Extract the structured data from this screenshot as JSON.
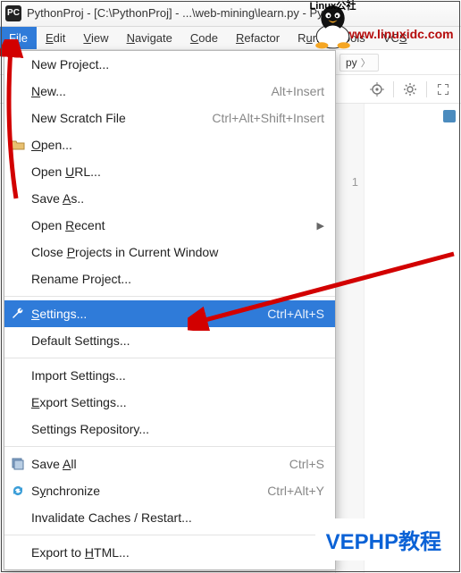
{
  "window": {
    "title": "PythonProj - [C:\\PythonProj] - ...\\web-mining\\learn.py - PyCh"
  },
  "menubar": {
    "items": [
      {
        "label": "File",
        "u": 0,
        "active": true
      },
      {
        "label": "Edit",
        "u": 0
      },
      {
        "label": "View",
        "u": 0
      },
      {
        "label": "Navigate",
        "u": 0
      },
      {
        "label": "Code",
        "u": 0
      },
      {
        "label": "Refactor",
        "u": 0
      },
      {
        "label": "Run",
        "u": 1
      },
      {
        "label": "Tools",
        "u": 0
      },
      {
        "label": "VCS",
        "u": 2
      }
    ]
  },
  "breadcrumb": {
    "tail": "py"
  },
  "dropdown": {
    "groups": [
      [
        {
          "label": "New Project..."
        },
        {
          "label": "New...",
          "u": 0,
          "shortcut": "Alt+Insert"
        },
        {
          "label": "New Scratch File",
          "shortcut": "Ctrl+Alt+Shift+Insert"
        },
        {
          "label": "Open...",
          "u": 0,
          "icon": "folder-open-icon"
        },
        {
          "label": "Open URL...",
          "u": 5
        },
        {
          "label": "Save As..",
          "u": 5
        },
        {
          "label": "Open Recent",
          "u": 5,
          "submenu": true
        },
        {
          "label": "Close Projects in Current Window",
          "u": 6
        },
        {
          "label": "Rename Project..."
        }
      ],
      [
        {
          "label": "Settings...",
          "u": 0,
          "shortcut": "Ctrl+Alt+S",
          "icon": "wrench-icon",
          "selected": true
        },
        {
          "label": "Default Settings..."
        }
      ],
      [
        {
          "label": "Import Settings..."
        },
        {
          "label": "Export Settings...",
          "u": 0
        },
        {
          "label": "Settings Repository..."
        }
      ],
      [
        {
          "label": "Save All",
          "u": 5,
          "shortcut": "Ctrl+S",
          "icon": "save-all-icon"
        },
        {
          "label": "Synchronize",
          "u": 1,
          "shortcut": "Ctrl+Alt+Y",
          "icon": "sync-icon"
        },
        {
          "label": "Invalidate Caches / Restart..."
        }
      ],
      [
        {
          "label": "Export to HTML...",
          "u": 10
        }
      ]
    ]
  },
  "editor": {
    "gutter_line": "1"
  },
  "overlays": {
    "url": "www.linuxidc.com",
    "vephp": "VEPHP教程",
    "linux_cn": "Linux公社"
  }
}
